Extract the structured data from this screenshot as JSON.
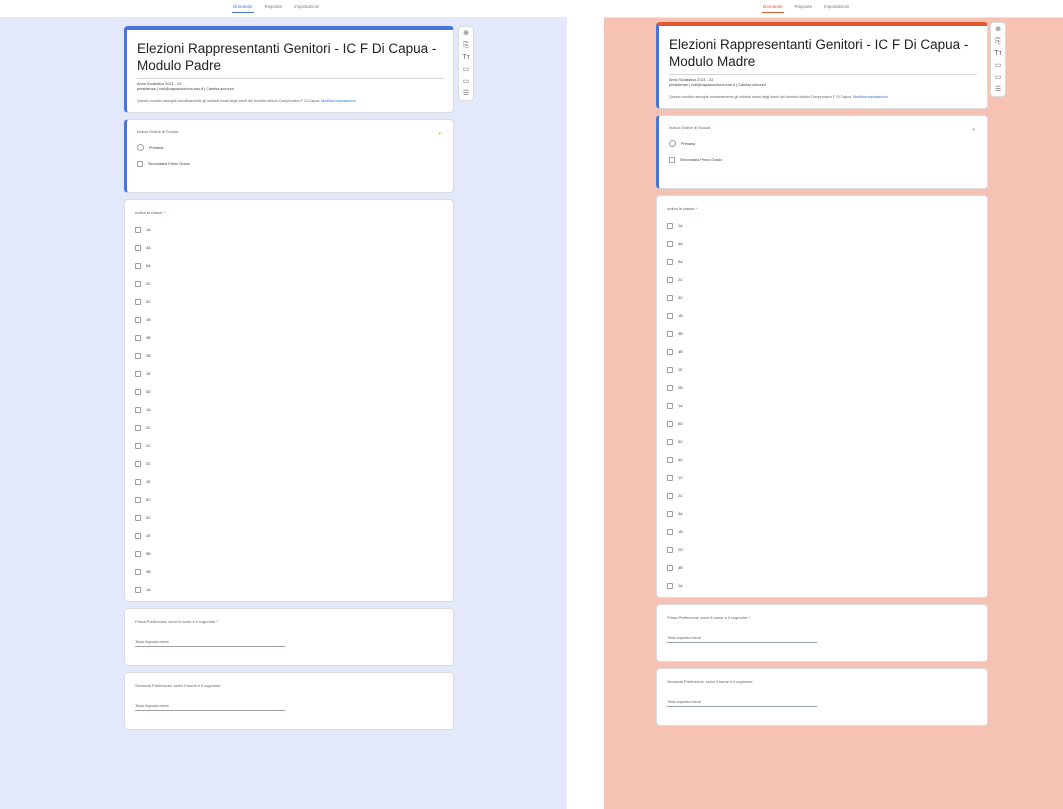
{
  "colors": {
    "left_bg": "#e3e9fb",
    "left_accent": "#4a74d9",
    "right_bg": "#f6c2b3",
    "right_accent": "#e4572e"
  },
  "tabs": [
    "Domande",
    "Risposte",
    "Impostazioni"
  ],
  "left": {
    "title": "Elezioni Rappresentanti Genitori - IC F Di Capua - Modulo Padre",
    "meta_line1": "Anno Scolastico 2021 - 22",
    "meta_line2": "presidenza ( rcdl@capuacnolona.edu.it ) Cambia account",
    "description": "Questo modulo raccoglie anonimamente gli indirizzi email degli utenti del dominio istituto Comprensivo F Di Capua.",
    "description_link": "Modifica impostazioni",
    "q1": {
      "label": "Indica Ordine di Scuola",
      "options": [
        "Primaria",
        "Secondaria Primo Grado"
      ]
    },
    "q2": {
      "label": "Indica la classe",
      "required_mark": "*",
      "options": [
        "1A",
        "4A",
        "5A",
        "2C",
        "3C",
        "1B",
        "3B",
        "2B",
        "1E",
        "5D",
        "1A",
        "2C",
        "2C",
        "3C",
        "1E",
        "5C",
        "3C",
        "1E",
        "5B",
        "4B",
        "1A"
      ]
    },
    "q3": {
      "label": "Prima Preferenza: scrivi il nome e il cognome",
      "required_mark": "*",
      "placeholder": "Testo risposta breve"
    },
    "q4": {
      "label": "Seconda Preferenza: scrivi il nome e il cognome",
      "placeholder": "Testo risposta breve"
    }
  },
  "right": {
    "title": "Elezioni Rappresentanti Genitori - IC F Di Capua - Modulo Madre",
    "meta_line1": "Anno Scolastico 2021 - 22",
    "meta_line2": "presidenza ( rcdl@capuacnolona.edu.it ) Cambia account",
    "description": "Questo modulo raccoglie anonimamente gli indirizzi email degli utenti del dominio istituto Comprensivo F Di Capua.",
    "description_link": "Modifica impostazioni",
    "q1": {
      "label": "Indica Ordine di Scuola",
      "options": [
        "Primaria",
        "Secondaria Primo Grado"
      ]
    },
    "q2": {
      "label": "Indica la classe",
      "required_mark": "*",
      "options": [
        "1A",
        "4A",
        "5A",
        "2C",
        "3C",
        "1B",
        "3B",
        "4B",
        "1E",
        "2B",
        "1A",
        "5D",
        "5C",
        "4C",
        "1C",
        "2C",
        "3A",
        "1B",
        "2D",
        "3B",
        "1A"
      ]
    },
    "q3": {
      "label": "Prima Preferenza: scrivi il nome e il cognome",
      "required_mark": "*",
      "placeholder": "Testo risposta breve"
    },
    "q4": {
      "label": "Seconda Preferenza: scrivi il nome e il cognome",
      "placeholder": "Testo risposta breve"
    }
  },
  "tools": [
    "add-question-icon",
    "import-questions-icon",
    "add-title-icon",
    "add-image-icon",
    "add-video-icon",
    "add-section-icon"
  ]
}
